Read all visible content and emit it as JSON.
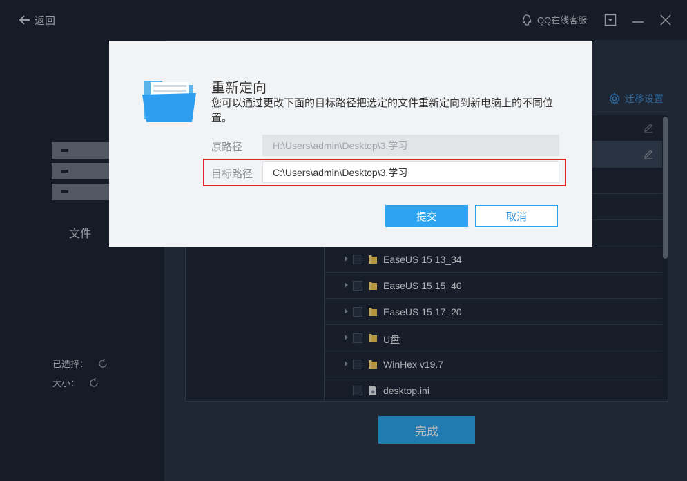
{
  "titlebar": {
    "back_label": "返回",
    "support_label": "QQ在线客服"
  },
  "left": {
    "file_label": "文件",
    "selected_label": "已选择：",
    "size_label": "大小："
  },
  "main": {
    "settings_label": "迁移设置",
    "done_label": "完成",
    "rows": [
      {
        "name": "EaseUS 15 13_34"
      },
      {
        "name": "EaseUS 15 15_40"
      },
      {
        "name": "EaseUS 15 17_20"
      },
      {
        "name": "U盘"
      },
      {
        "name": "WinHex v19.7"
      },
      {
        "name": "desktop.ini"
      }
    ]
  },
  "dialog": {
    "title": "重新定向",
    "description": "您可以通过更改下面的目标路径把选定的文件重新定向到新电脑上的不同位置。",
    "source_label": "原路径",
    "source_path": "H:\\Users\\admin\\Desktop\\3.学习",
    "target_label": "目标路径",
    "target_path": "C:\\Users\\admin\\Desktop\\3.学习",
    "submit_label": "提交",
    "cancel_label": "取消"
  },
  "colors": {
    "accent": "#2ea3ef",
    "highlight": "#e0282a",
    "background": "#2b3446",
    "sidebar": "#1e2634"
  }
}
